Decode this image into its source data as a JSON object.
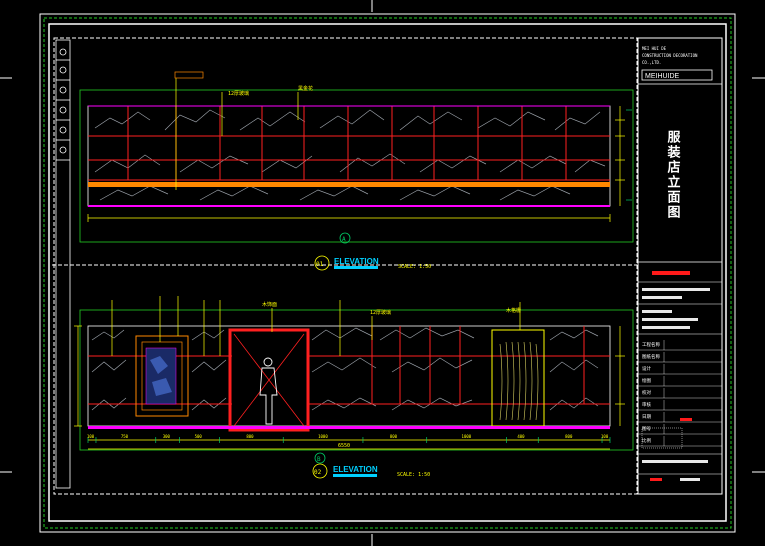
{
  "colors": {
    "background": "#000000",
    "frame": "#ffffff",
    "frame_dashed": "#22cc22",
    "wall_red": "#ff2020",
    "magenta": "#ff00ff",
    "yellow": "#ffff00",
    "orange": "#ff8800",
    "dim_green": "#00cc66",
    "cyan": "#00d0ff",
    "marble_gray": "#9aa0a8",
    "title_red": "#ff1a1a",
    "block_white": "#e8e8e8"
  },
  "upper_elevation": {
    "top_annotation_1": "12厚玻璃",
    "top_annotation_2": "黑金花",
    "callout_text": "3",
    "section_marker": "A",
    "label": "ELEVATION",
    "scale": "SCALE: 1:50",
    "marker_number": "01"
  },
  "lower_elevation": {
    "annotation_door": "木饰面",
    "annotation_mid": "12厚玻璃",
    "annotation_right": "木格栅",
    "section_marker": "B",
    "label": "ELEVATION",
    "scale": "SCALE: 1:50",
    "marker_number": "02",
    "dimensions": [
      "100",
      "750",
      "300",
      "500",
      "800",
      "1000",
      "800",
      "1000",
      "400",
      "800",
      "100"
    ],
    "total_dimension": "6550"
  },
  "title_block": {
    "company_line_1": "MEI HUI DE",
    "company_line_2": "CONSTRUCTION DECORATION",
    "company_line_3": "CO.,LTD.",
    "logo_text": "MEIHUIDE",
    "drawing_title": "服装店立面图",
    "row_labels": [
      "工程名称",
      "图纸名称",
      "设计",
      "绘图",
      "校对",
      "审核",
      "日期",
      "图号",
      "比例"
    ]
  }
}
